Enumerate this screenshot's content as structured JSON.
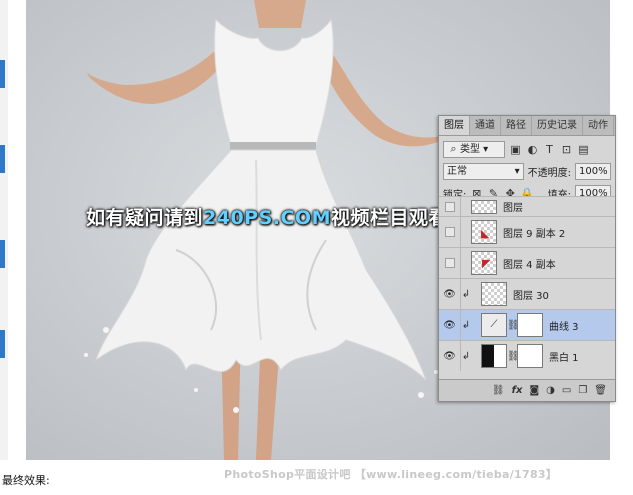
{
  "watermark": {
    "prefix": "如有疑问请到",
    "highlight": "240PS.COM",
    "suffix": "视频栏目观看视频教程"
  },
  "panel": {
    "tabs": [
      "图层",
      "通道",
      "路径",
      "历史记录",
      "动作"
    ],
    "filter": {
      "value": "类型",
      "icon": "search-icon"
    },
    "blend_mode": "正常",
    "opacity_label": "不透明度:",
    "opacity_value": "100%",
    "lock_label": "锁定:",
    "fill_label": "填充:",
    "fill_value": "100%",
    "layers": [
      {
        "name": "图层",
        "visible": false,
        "selected": false,
        "kind": "partial"
      },
      {
        "name": "图层 9 副本 2",
        "visible": false,
        "selected": false,
        "kind": "pixel"
      },
      {
        "name": "图层 4 副本",
        "visible": false,
        "selected": false,
        "kind": "pixel"
      },
      {
        "name": "图层 30",
        "visible": true,
        "selected": false,
        "kind": "pixel",
        "clipped": true
      },
      {
        "name": "曲线 3",
        "visible": true,
        "selected": true,
        "kind": "curves",
        "clipped": true
      },
      {
        "name": "黑白 1",
        "visible": true,
        "selected": false,
        "kind": "bw",
        "clipped": true
      }
    ],
    "footer_icons": [
      "link-icon",
      "fx-icon",
      "mask-icon",
      "adjustment-icon",
      "folder-icon",
      "new-layer-icon",
      "trash-icon"
    ],
    "footer_fx": "fx"
  },
  "page": {
    "final_label": "最终效果:",
    "credit": "PhotoShop平面设计吧 【www.lineeg.com/tieba/1783】"
  },
  "colors": {
    "selected_layer": "#b4c9ec",
    "watermark_highlight": "#5fd0ff",
    "panel_bg": "#d6d6d6"
  }
}
